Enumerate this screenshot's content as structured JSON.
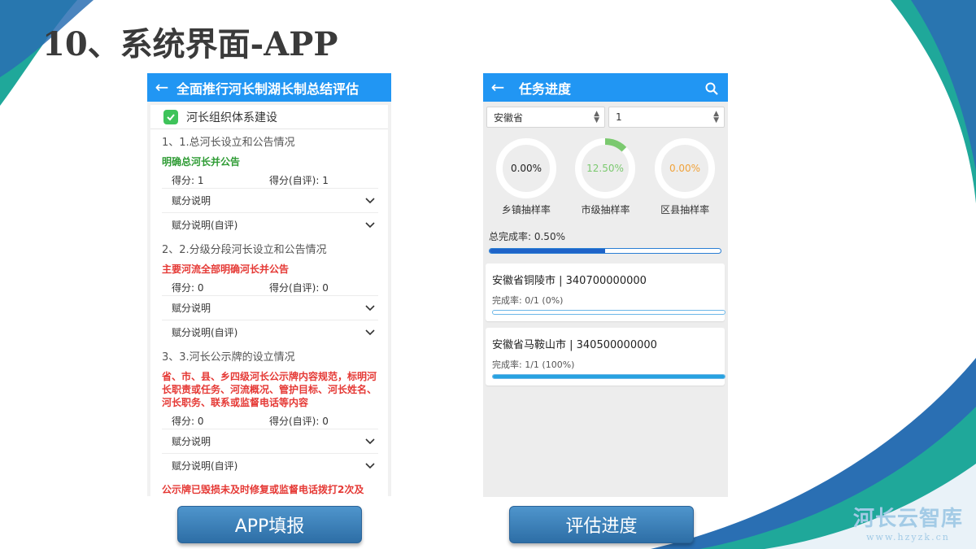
{
  "slide": {
    "title": "10、系统界面-APP"
  },
  "app_fill": {
    "header": {
      "back_icon": "arrow-left-icon",
      "title": "全面推行河长制湖长制总结评估"
    },
    "section": {
      "icon": "check-badge-icon",
      "title": "河长组织体系建设"
    },
    "items": [
      {
        "question": "1、1.总河长设立和公告情况",
        "standard": "明确总河长并公告",
        "standard_color": "#2e9b34",
        "score": "得分: 1",
        "self_score": "得分(自评): 1",
        "explain": "赋分说明",
        "explain_self": "赋分说明(自评)"
      },
      {
        "question": "2、2.分级分段河长设立和公告情况",
        "standard": "主要河流全部明确河长并公告",
        "standard_color": "#e53935",
        "score": "得分: 0",
        "self_score": "得分(自评): 0",
        "explain": "赋分说明",
        "explain_self": "赋分说明(自评)"
      },
      {
        "question": "3、3.河长公示牌的设立情况",
        "standard": "省、市、县、乡四级河长公示牌内容规范，标明河长职责或任务、河流概况、管护目标、河长姓名、河长职务、联系或监督电话等内容",
        "standard_color": "#e53935",
        "score": "得分: 0",
        "self_score": "得分(自评): 0",
        "explain": "赋分说明",
        "explain_self": "赋分说明(自评)"
      }
    ],
    "cut_off_text": "公示牌已毁损未及时修复或监督电话拨打2次及"
  },
  "progress_app": {
    "header": {
      "back_icon": "arrow-left-icon",
      "title": "任务进度",
      "search_icon": "search-icon"
    },
    "province_select": "安徽省",
    "round_select": "1",
    "gauges": [
      {
        "value": "0.00%",
        "fraction": 0.0,
        "label": "乡镇抽样率",
        "color": "#222222"
      },
      {
        "value": "12.50%",
        "fraction": 0.125,
        "label": "市级抽样率",
        "color": "#7bc96f"
      },
      {
        "value": "0.00%",
        "fraction": 0.0,
        "label": "区县抽样率",
        "color": "#f0a23a"
      }
    ],
    "total_label": "总完成率: 0.50%",
    "total_fraction": 0.5,
    "cities": [
      {
        "title": "安徽省铜陵市 | 340700000000",
        "rate": "完成率: 0/1 (0%)",
        "fraction": 0.0
      },
      {
        "title": "安徽省马鞍山市 | 340500000000",
        "rate": "完成率: 1/1 (100%)",
        "fraction": 1.0
      }
    ]
  },
  "buttons": {
    "left": "APP填报",
    "right": "评估进度"
  },
  "watermark": {
    "name": "河长云智库",
    "url": "www.hzyzk.cn"
  },
  "colors": {
    "app_bar": "#2196f3",
    "button": "#3a7fb8",
    "accent_teal": "#1aa39a"
  }
}
